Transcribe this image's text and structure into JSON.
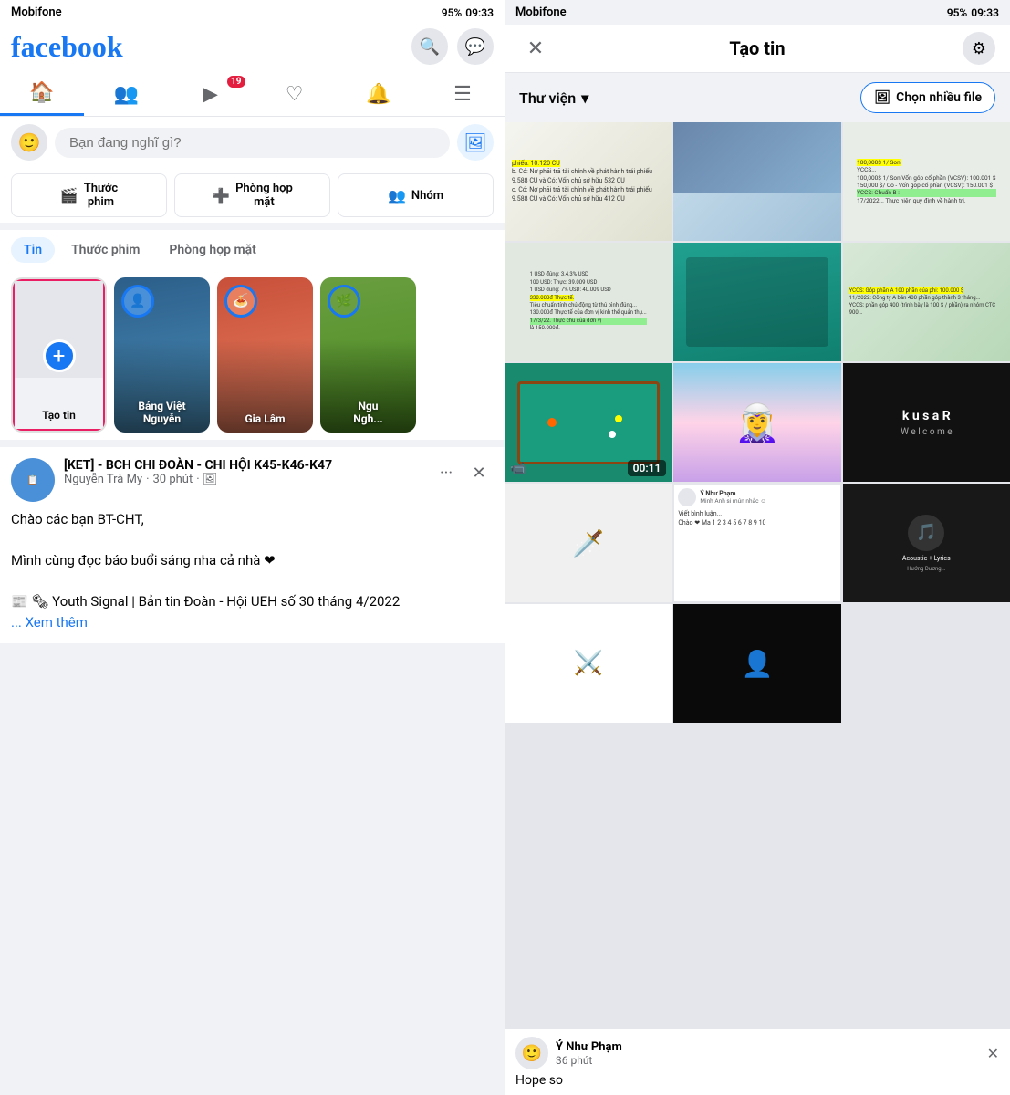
{
  "left": {
    "statusBar": {
      "carrier": "Mobifone",
      "battery": "95%",
      "time": "09:33"
    },
    "header": {
      "logo": "facebook",
      "searchIcon": "🔍",
      "messengerIcon": "💬"
    },
    "navTabs": [
      {
        "icon": "🏠",
        "active": true,
        "badge": null
      },
      {
        "icon": "👥",
        "active": false,
        "badge": null
      },
      {
        "icon": "▶",
        "active": false,
        "badge": "19"
      },
      {
        "icon": "♡",
        "active": false,
        "badge": null
      },
      {
        "icon": "🔔",
        "active": false,
        "badge": null
      },
      {
        "icon": "☰",
        "active": false,
        "badge": null
      }
    ],
    "searchPlaceholder": "Bạn đang nghĩ gì?",
    "quickActions": [
      {
        "icon": "🎬",
        "label": "Thước\nphim"
      },
      {
        "icon": "➕",
        "label": "Phòng họp\nmặt"
      },
      {
        "icon": "👥",
        "label": "Nhóm"
      }
    ],
    "sectionTabs": [
      "Tin",
      "Thước phim",
      "Phòng họp mặt"
    ],
    "activeSectionTab": 0,
    "stories": [
      {
        "type": "create",
        "label": "Tạo tin"
      },
      {
        "type": "story",
        "name": "Bảng Việt\nNguyễn"
      },
      {
        "type": "story",
        "name": "Gia Lâm"
      },
      {
        "type": "story",
        "name": "Ngu\nNgh..."
      }
    ],
    "post": {
      "groupName": "[KET] - BCH CHI ĐOÀN - CHI HỘI K45-K46-K47",
      "author": "Nguyễn Trà My",
      "time": "30 phút",
      "hasPhoto": true,
      "text1": "Chào các bạn BT-CHT,",
      "text2": "Mình cùng đọc báo buổi sáng nha cả nhà ❤",
      "linkTitle": "🗞 Youth Signal | Bản tin Đoàn - Hội UEH số 30 tháng 4/2022",
      "readMore": "... Xem thêm"
    }
  },
  "right": {
    "statusBar": {
      "carrier": "Mobifone",
      "battery": "95%",
      "time": "09:33"
    },
    "header": {
      "closeIcon": "✕",
      "title": "Tạo tin",
      "settingsIcon": "⚙"
    },
    "libraryBar": {
      "libraryLabel": "Thư viện",
      "dropdownIcon": "▾",
      "chooseMultipleLabel": "Chọn nhiều file",
      "photoIcon": "🖼"
    },
    "photoGrid": [
      {
        "type": "doc",
        "class": "pc-doc",
        "selected": false
      },
      {
        "type": "image",
        "class": "pc-blue",
        "selected": false
      },
      {
        "type": "image",
        "class": "pc-doc2",
        "selected": false
      },
      {
        "type": "image",
        "class": "pc-doc2",
        "selected": false
      },
      {
        "type": "image",
        "class": "pc-teal",
        "selected": false
      },
      {
        "type": "image",
        "class": "pc-doc2",
        "selected": false
      },
      {
        "type": "video",
        "class": "pc-pool",
        "duration": "00:11",
        "selected": true
      },
      {
        "type": "anime",
        "class": "pc-anime",
        "selected": false
      },
      {
        "type": "dark",
        "class": "pc-dark1",
        "selected": false
      },
      {
        "type": "manga",
        "class": "pc-manga",
        "selected": false
      },
      {
        "type": "kusa",
        "class": "pc-dark2",
        "selected": false
      },
      {
        "type": "fb-post",
        "class": "pc-fb",
        "selected": false
      },
      {
        "type": "music",
        "class": "pc-music",
        "selected": false
      },
      {
        "type": "manga2",
        "class": "pc-manga",
        "selected": false
      }
    ],
    "overlay": {
      "username": "Ý Như Phạm",
      "time": "36 phút",
      "caption": "Hope so",
      "closeIcon": "✕"
    }
  }
}
